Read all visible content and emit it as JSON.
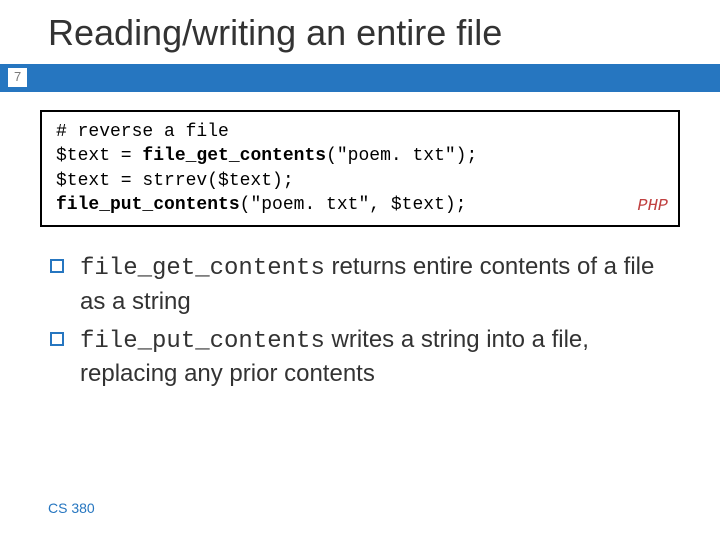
{
  "title": "Reading/writing an entire file",
  "page_number": "7",
  "code": {
    "line1_text": "# reverse a file",
    "line2_pre": "$text = ",
    "line2_fn": "file_get_contents",
    "line2_post": "(\"poem. txt\");",
    "line3_text": "$text = strrev($text);",
    "line4_fn": "file_put_contents",
    "line4_args": "(\"poem. txt\", $text);",
    "lang_label": "PHP"
  },
  "bullets": [
    {
      "code1": "file_get_contents",
      "text1": " returns entire contents of a file as a string"
    },
    {
      "code1": "file_put_contents",
      "text1": "  writes a string into a file, replacing any prior contents"
    }
  ],
  "footer": "CS 380"
}
